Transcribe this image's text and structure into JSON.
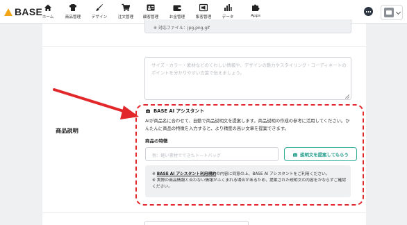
{
  "logo": {
    "text": "BASE"
  },
  "nav": [
    {
      "label": "ホーム",
      "icon": "home-icon"
    },
    {
      "label": "商品管理",
      "icon": "shirt-icon"
    },
    {
      "label": "デザイン",
      "icon": "brush-icon"
    },
    {
      "label": "注文管理",
      "icon": "cart-icon"
    },
    {
      "label": "顧客管理",
      "icon": "contact-card-icon"
    },
    {
      "label": "お金管理",
      "icon": "wallet-icon"
    },
    {
      "label": "集客管理",
      "icon": "megaphone-icon"
    },
    {
      "label": "データ",
      "icon": "bar-chart-icon"
    },
    {
      "label": "Apps",
      "icon": "puzzle-icon"
    }
  ],
  "image_note": {
    "text": "※ 対応ファイル：jpg,png,gif"
  },
  "description": {
    "label": "商品説明",
    "placeholder": "サイズ・カラー・素材などのくわしい情報や、デザインの魅力やスタイリング・コーディネートのポイントを分かりやすい言葉で伝えましょう。"
  },
  "ai_assistant": {
    "title": "BASE AI アシスタント",
    "description": "AIが商品名に合わせて、自動で商品説明文を提案します。商品説明の作成の参考に活用してください。かんたんに商品の特徴を入力すると、より精度の高い文章を提案できます。",
    "feature_label": "商品の特徴",
    "feature_placeholder": "例：軽い素材でできたトートバッグ",
    "button_label": "説明文を提案してもらう",
    "notice_link": "BASE AI アシスタント利用規約",
    "notice_1_rest": "の内容に同意の上、BASE AI アシスタントをご利用ください。",
    "notice_2": "※ 実際の商品情報と合わない情報がふくまれる場合があるため、提案された説明文の内容をかならずご確認ください。",
    "notice_mark": "※"
  },
  "colors": {
    "accent": "#2fae9c",
    "highlight": "#e2272b",
    "logo": "#f2a516"
  }
}
